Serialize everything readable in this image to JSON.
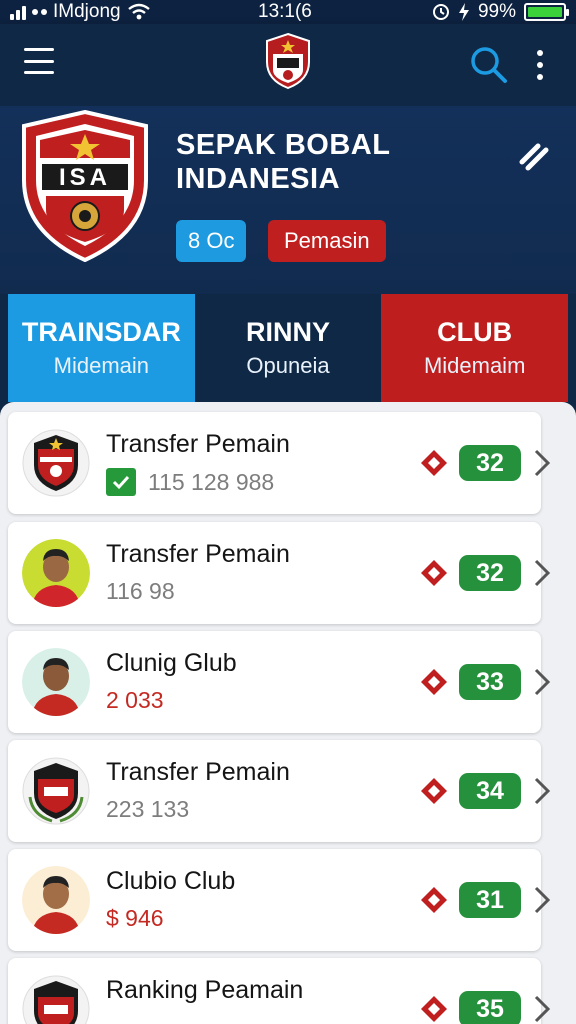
{
  "status_bar": {
    "carrier": "IMdjong",
    "time": "13:1(6",
    "battery": "99%",
    "battery_level": 0.99
  },
  "nav": {
    "menu_icon": "hamburger-icon",
    "logo_icon": "club-logo-icon",
    "search_icon": "search-icon",
    "more_icon": "more-vertical-icon"
  },
  "header": {
    "title": "SEPAK BOBAL INDANESIA",
    "crest_text": "ISA",
    "badge_blue": "8 Oc",
    "badge_red": "Pemasin",
    "edit_icon": "edit-icon"
  },
  "tabs": [
    {
      "title": "TRAINSDAR",
      "sub": "Midemain"
    },
    {
      "title": "RINNY",
      "sub": "Opuneia"
    },
    {
      "title": "CLUB",
      "sub": "Midemaim"
    }
  ],
  "items": [
    {
      "title": "Transfer Pemain",
      "sub": "115   128 988",
      "score": "32",
      "checked": true
    },
    {
      "title": "Transfer Pemain",
      "sub": "116  98",
      "score": "32"
    },
    {
      "title": "Clunig Glub",
      "sub": "2 033",
      "score": "33"
    },
    {
      "title": "Transfer Pemain",
      "sub": "223 133",
      "score": "34"
    },
    {
      "title": "Clubio Club",
      "sub": "$ 946",
      "score": "31"
    },
    {
      "title": "Ranking Peamain",
      "sub": "",
      "score": "35"
    }
  ],
  "colors": {
    "navy": "#0f2846",
    "blue": "#1d9be2",
    "red": "#bf1e1e",
    "green": "#25913c"
  }
}
